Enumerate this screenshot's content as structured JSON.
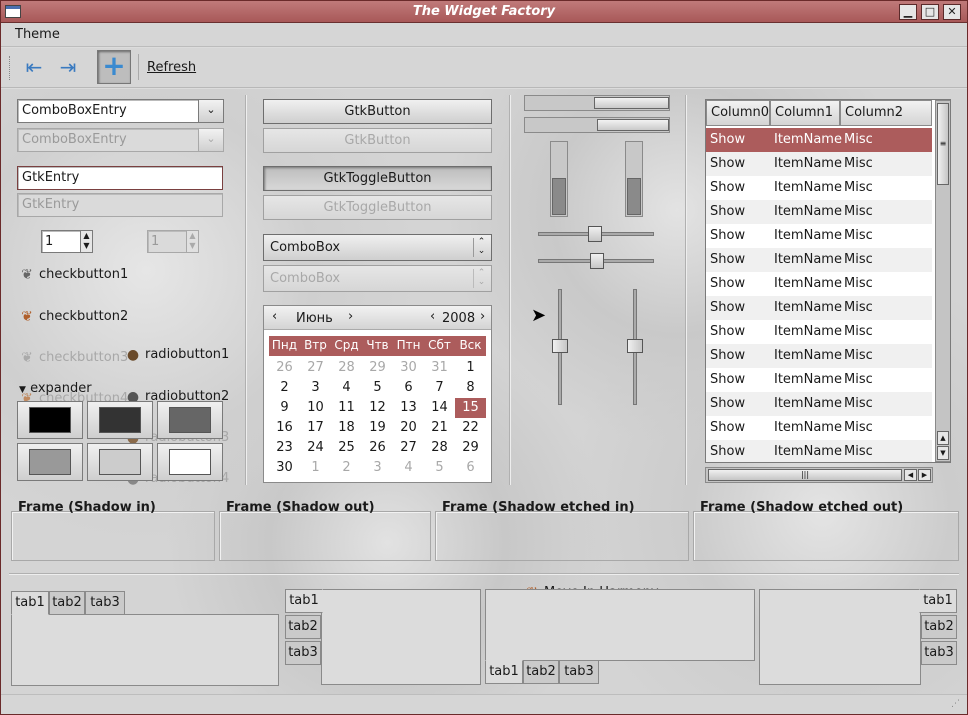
{
  "window": {
    "title": "The Widget Factory"
  },
  "menu": {
    "theme": "Theme"
  },
  "toolbar": {
    "refresh": "Refresh"
  },
  "combos": {
    "entry1": "ComboBoxEntry",
    "entry2": "ComboBoxEntry",
    "combo1": "ComboBox",
    "combo2": "ComboBox"
  },
  "entries": {
    "e1": "GtkEntry",
    "e2": "GtkEntry"
  },
  "spin": {
    "v1": "1",
    "v2": "1"
  },
  "checks": [
    {
      "label": "checkbutton1"
    },
    {
      "label": "checkbutton2"
    },
    {
      "label": "checkbutton3"
    },
    {
      "label": "checkbutton4"
    }
  ],
  "radios": [
    {
      "label": "radiobutton1"
    },
    {
      "label": "radiobutton2"
    },
    {
      "label": "radiobutton3"
    },
    {
      "label": "radiobutton4"
    }
  ],
  "expander": {
    "label": "expander"
  },
  "buttons": {
    "b1": "GtkButton",
    "b2": "GtkButton",
    "t1": "GtkToggleButton",
    "t2": "GtkToggleButton"
  },
  "swatches": [
    "#000000",
    "#333333",
    "#666666",
    "#999999",
    "#cccccc",
    "#ffffff"
  ],
  "calendar": {
    "month": "Июнь",
    "year": "2008",
    "selected": "15",
    "weekdays": [
      "Пнд",
      "Втр",
      "Срд",
      "Чтв",
      "Птн",
      "Сбт",
      "Вск"
    ],
    "rows": [
      [
        "26",
        "27",
        "28",
        "29",
        "30",
        "31",
        "1"
      ],
      [
        "2",
        "3",
        "4",
        "5",
        "6",
        "7",
        "8"
      ],
      [
        "9",
        "10",
        "11",
        "12",
        "13",
        "14",
        "15"
      ],
      [
        "16",
        "17",
        "18",
        "19",
        "20",
        "21",
        "22"
      ],
      [
        "23",
        "24",
        "25",
        "26",
        "27",
        "28",
        "29"
      ],
      [
        "30",
        "1",
        "2",
        "3",
        "4",
        "5",
        "6"
      ]
    ]
  },
  "progress": {
    "p1": 0.48,
    "p2": 0.5,
    "v1": 0.5,
    "v2": 0.5
  },
  "harmony": {
    "label": "Move In Harmony"
  },
  "tree": {
    "columns": [
      "Column0",
      "Column1",
      "Column2"
    ],
    "rows": [
      [
        "Show",
        "ItemName",
        "Misc"
      ],
      [
        "Show",
        "ItemName",
        "Misc"
      ],
      [
        "Show",
        "ItemName",
        "Misc"
      ],
      [
        "Show",
        "ItemName",
        "Misc"
      ],
      [
        "Show",
        "ItemName",
        "Misc"
      ],
      [
        "Show",
        "ItemName",
        "Misc"
      ],
      [
        "Show",
        "ItemName",
        "Misc"
      ],
      [
        "Show",
        "ItemName",
        "Misc"
      ],
      [
        "Show",
        "ItemName",
        "Misc"
      ],
      [
        "Show",
        "ItemName",
        "Misc"
      ],
      [
        "Show",
        "ItemName",
        "Misc"
      ],
      [
        "Show",
        "ItemName",
        "Misc"
      ],
      [
        "Show",
        "ItemName",
        "Misc"
      ],
      [
        "Show",
        "ItemName",
        "Misc"
      ]
    ]
  },
  "frames": [
    "Frame (Shadow in)",
    "Frame (Shadow out)",
    "Frame (Shadow etched in)",
    "Frame (Shadow etched out)"
  ],
  "notebooks": {
    "tabs": [
      "tab1",
      "tab2",
      "tab3"
    ]
  },
  "colors": {
    "accent": "#ac5c5c",
    "title_gradient_top": "#c07a7a",
    "title_gradient_bottom": "#a85858"
  }
}
